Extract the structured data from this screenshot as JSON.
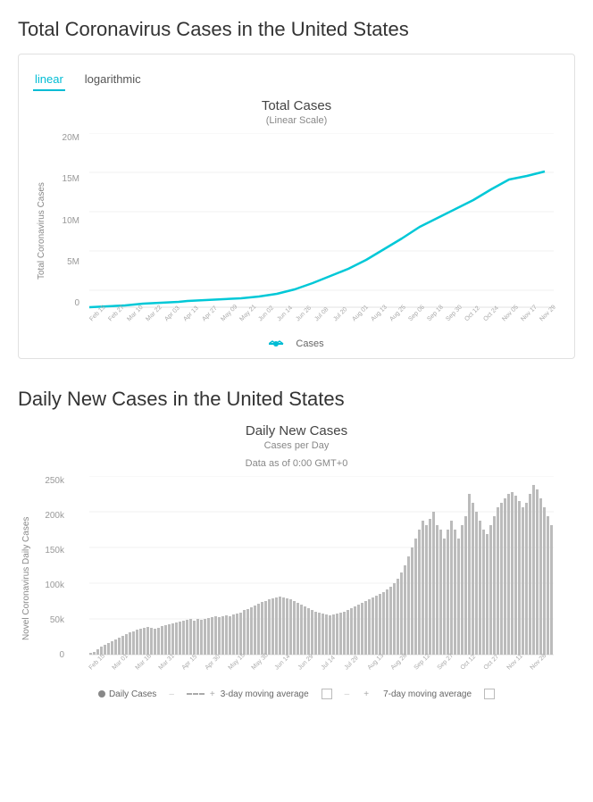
{
  "section1": {
    "title": "Total Coronavirus Cases in the United States",
    "tab_linear": "linear",
    "tab_log": "logarithmic",
    "chart_title": "Total Cases",
    "chart_subtitle": "(Linear Scale)",
    "y_axis_label": "Total Coronavirus Cases",
    "y_labels": [
      "20M",
      "15M",
      "10M",
      "5M",
      "0"
    ],
    "x_labels": [
      "Feb 15",
      "Feb 27",
      "Mar 10",
      "Mar 22",
      "Apr 03",
      "Apr 13",
      "Apr 27",
      "May 09",
      "May 21",
      "Jun 02",
      "Jun 14",
      "Jun 26",
      "Jul 08",
      "Jul 20",
      "Aug 01",
      "Aug 13",
      "Aug 25",
      "Sep 06",
      "Sep 18",
      "Sep 30",
      "Oct 12",
      "Oct 24",
      "Nov 05",
      "Nov 17",
      "Nov 29"
    ],
    "legend_label": "Cases"
  },
  "section2": {
    "title": "Daily New Cases in the United States",
    "chart_title": "Daily New Cases",
    "chart_subtitle1": "Cases per Day",
    "chart_subtitle2": "Data as of 0:00 GMT+0",
    "y_axis_label": "Novel Coronavirus Daily Cases",
    "y_labels": [
      "250k",
      "200k",
      "150k",
      "100k",
      "50k",
      "0"
    ],
    "x_labels": [
      "Feb 15",
      "Mar 01",
      "Mar 16",
      "Mar 31",
      "Apr 15",
      "Apr 30",
      "May 15",
      "May 30",
      "Jun 14",
      "Jun 29",
      "Jul 14",
      "Jul 29",
      "Aug 13",
      "Aug 28",
      "Sep 12",
      "Sep 27",
      "Oct 12",
      "Oct 27",
      "Nov 11",
      "Nov 26"
    ],
    "legend_daily": "Daily Cases",
    "legend_3day": "3-day moving average",
    "legend_7day": "7-day moving average"
  }
}
